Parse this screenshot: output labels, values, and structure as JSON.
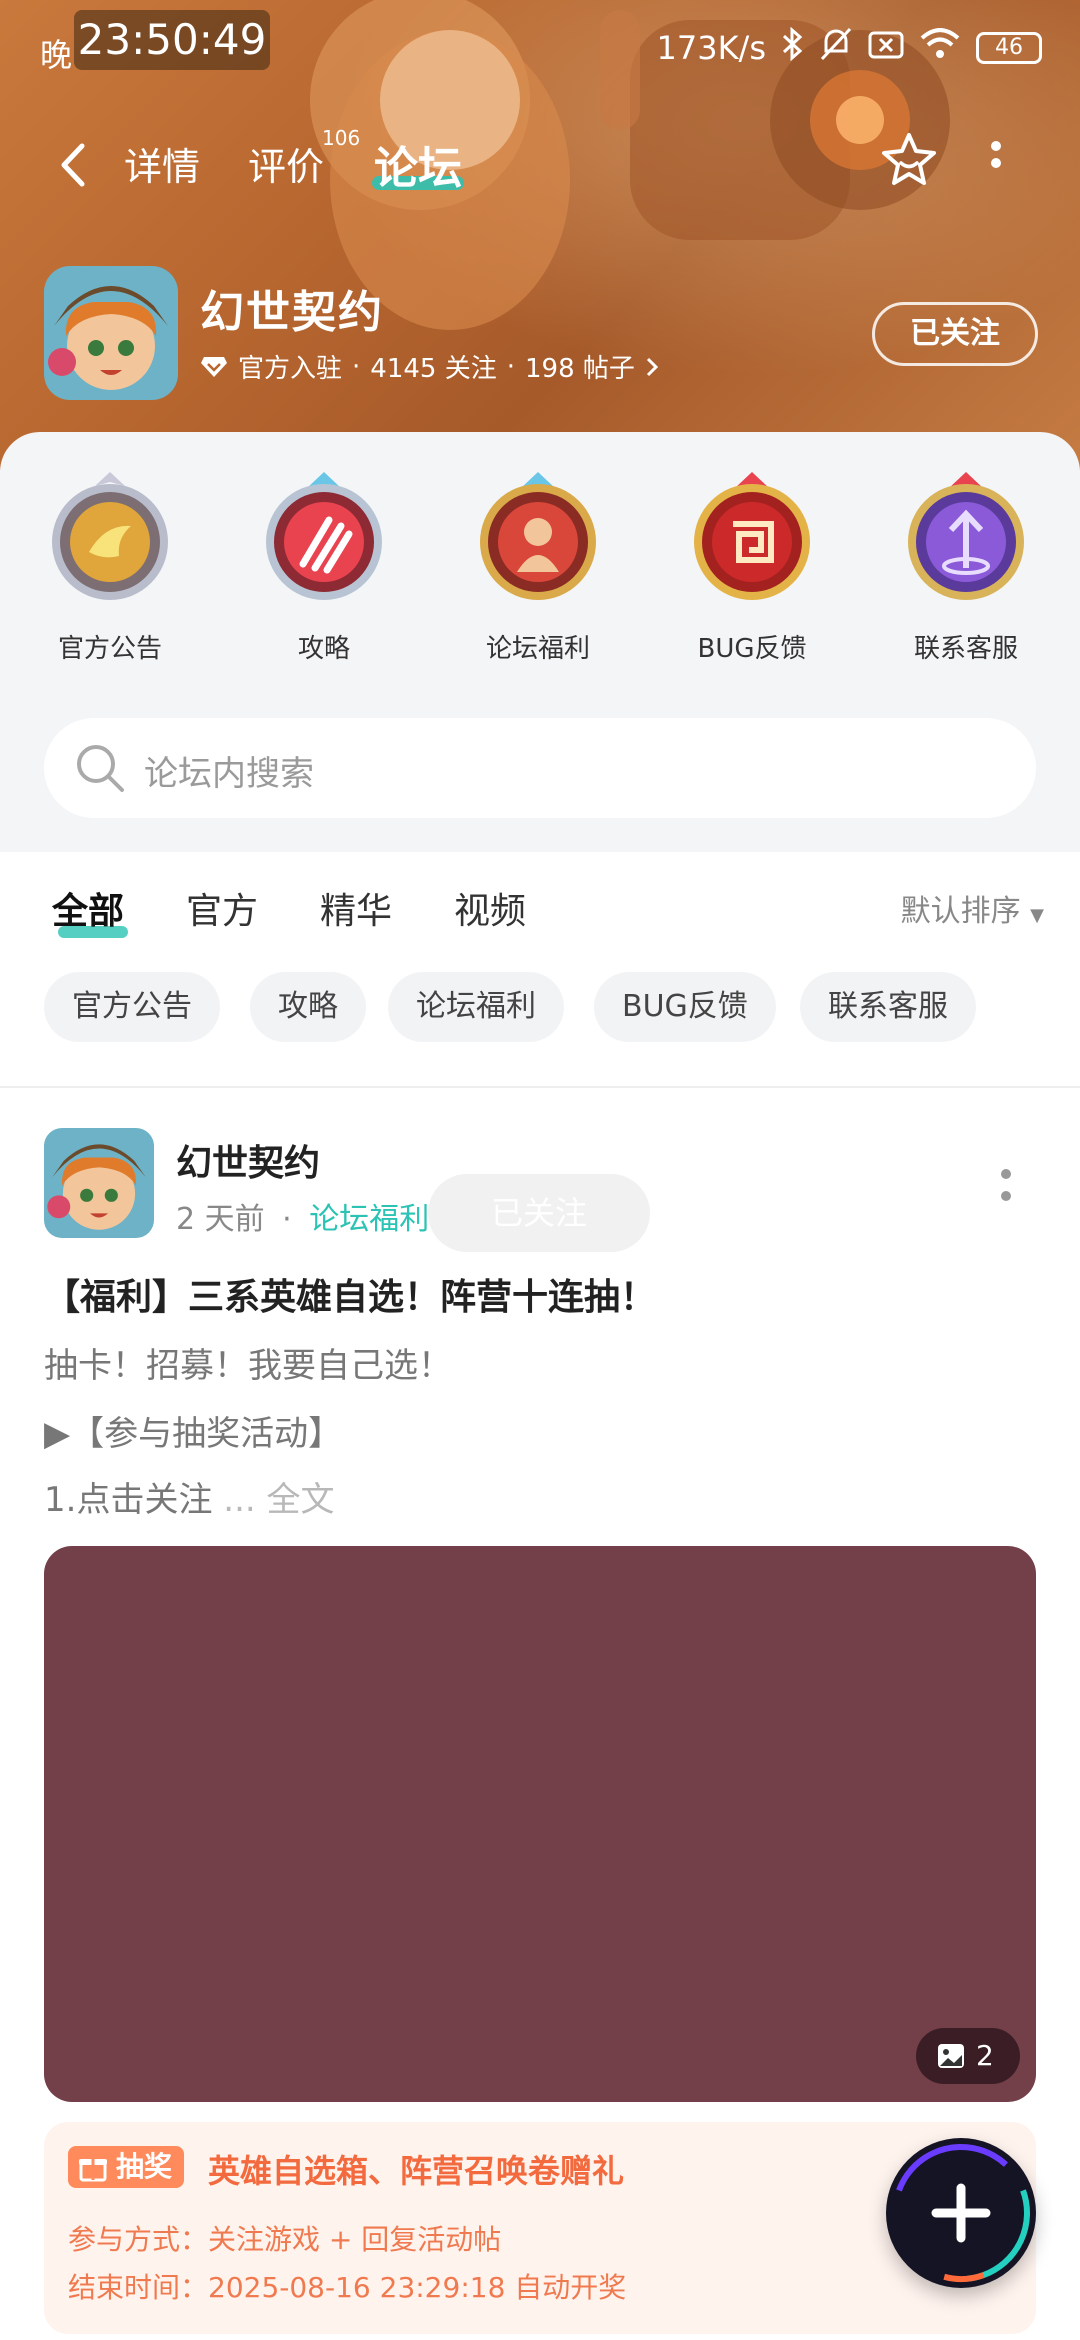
{
  "status_bar": {
    "ampm": "晚",
    "time": "23:50:49",
    "net_speed": "173K/s",
    "battery": "46"
  },
  "nav": {
    "tabs": [
      {
        "label": "详情",
        "active": false
      },
      {
        "label": "评价",
        "active": false,
        "badge": "106"
      },
      {
        "label": "论坛",
        "active": true
      }
    ],
    "icons": [
      "back-arrow-icon",
      "star-icon",
      "more-vertical-icon"
    ]
  },
  "game": {
    "name": "幻世契约",
    "official": "官方入驻",
    "followers": "4145 关注",
    "posts": "198 帖子",
    "follow_button": "已关注"
  },
  "categories": [
    {
      "label": "官方公告",
      "color": "#e0a53b"
    },
    {
      "label": "攻略",
      "color": "#e8434f"
    },
    {
      "label": "论坛福利",
      "color": "#d9473a"
    },
    {
      "label": "BUG反馈",
      "color": "#cc2a2a"
    },
    {
      "label": "联系客服",
      "color": "#8a5ad8"
    }
  ],
  "search": {
    "placeholder": "论坛内搜索"
  },
  "filter_tabs": [
    {
      "label": "全部",
      "active": true
    },
    {
      "label": "官方",
      "active": false
    },
    {
      "label": "精华",
      "active": false
    },
    {
      "label": "视频",
      "active": false
    }
  ],
  "sort_label": "默认排序",
  "chips": [
    "官方公告",
    "攻略",
    "论坛福利",
    "BUG反馈",
    "联系客服"
  ],
  "post": {
    "author": "幻世契约",
    "time": "2 天前",
    "dot": "·",
    "tag": "论坛福利",
    "ghost_follow": "已关注",
    "title": "【福利】三系英雄自选！阵营十连抽！",
    "line1": "抽卡！招募！我要自己选！",
    "line2": "▶【参与抽奖活动】",
    "line3": "1.点击关注",
    "read_more": "... 全文",
    "image_color": "#733f48",
    "image_count": "2"
  },
  "lottery": {
    "tag": "抽奖",
    "title": "英雄自选箱、阵营召唤卷赠礼",
    "method": "参与方式：关注游戏 + 回复活动帖",
    "end_time": "结束时间：2025-08-16 23:29:18 自动开奖"
  },
  "colors": {
    "accent": "#2cc3b4",
    "lottery": "#f26a3d"
  }
}
